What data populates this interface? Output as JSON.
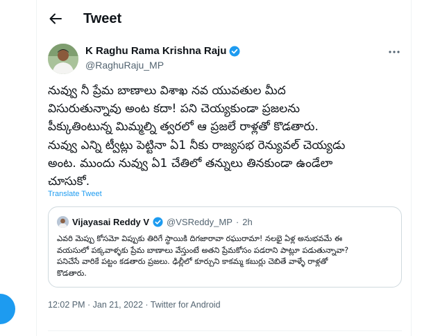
{
  "header": {
    "back_icon": "arrow-left-icon",
    "title": "Tweet"
  },
  "tweet": {
    "author_name": "K Raghu Rama Krishna Raju",
    "author_handle": "@RaghuRaju_MP",
    "verified_icon": "verified-badge-icon",
    "more_icon": "more-horizontal-icon",
    "text": "నువ్వు నీ ప్రేమ బాణాలు విశాఖ నవ యువతుల మీద\nవిసురుతున్నావు అంట కదా! పని చెయ్యకుండా ప్రజలను\nపీక్కుతింటున్న మిమ్మల్ని త్వరలో ఆ ప్రజలే రాళ్లతో కొడతారు.\nనువ్వు ఎన్ని ట్వీట్లు పెట్టినా ఏ1 నీకు రాజ్యసభ రెన్యువల్ చెయ్యడు\nఅంట. ముందు నువ్వు ఏ1 చేతిలో తన్నులు తినకుండా ఉండేలా\nచూసుకో.",
    "translate_label": "Translate Tweet",
    "meta": "12:02 PM · Jan 21, 2022 · Twitter for Android"
  },
  "quote": {
    "author_name": "Vijayasai Reddy V",
    "author_handle": "@VSReddy_MP",
    "separator": "·",
    "time": "2h",
    "text": "ఎవరి మెప్పు కోసమో విప్పుకు తిరిగే స్థాయికి దిగజారావా రఘురామా! నలభై ఏళ్ల అనుభవమే ఈ\nవయసులో పక్కవాళ్ళకు ప్రేమ బాణాలు వేస్తుంటే అతని ప్రేమకోసం పడరాని పాట్లూ పడుతున్నావా?\nపనిచేసే వారికే పట్టం కడతారు ప్రజలు. ఢిల్లీలో కూర్చుని కాకమ్మ కబుర్లు చెబితే వాళ్ళే రాళ్లతో\nకొడతారు."
  },
  "colors": {
    "accent": "#1d9bf0",
    "text": "#0f1419",
    "secondary": "#536471",
    "border": "#cfd9de"
  }
}
